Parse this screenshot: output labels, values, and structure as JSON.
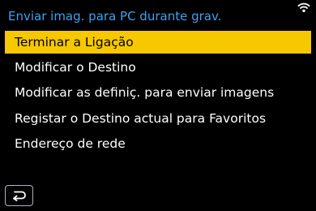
{
  "header": {
    "title": "Enviar imag. para PC durante grav."
  },
  "status": {
    "wifi_icon": "wifi-icon"
  },
  "menu": {
    "selected_color": "#f7c800",
    "title_color": "#3fa1f0",
    "items": [
      {
        "label": "Terminar a Ligação",
        "selected": true
      },
      {
        "label": "Modificar o Destino",
        "selected": false
      },
      {
        "label": "Modificar as definiç. para enviar imagens",
        "selected": false
      },
      {
        "label": "Registar o Destino actual para Favoritos",
        "selected": false
      },
      {
        "label": "Endereço de rede",
        "selected": false
      }
    ]
  },
  "footer": {
    "back_icon": "return-arrow-icon"
  }
}
